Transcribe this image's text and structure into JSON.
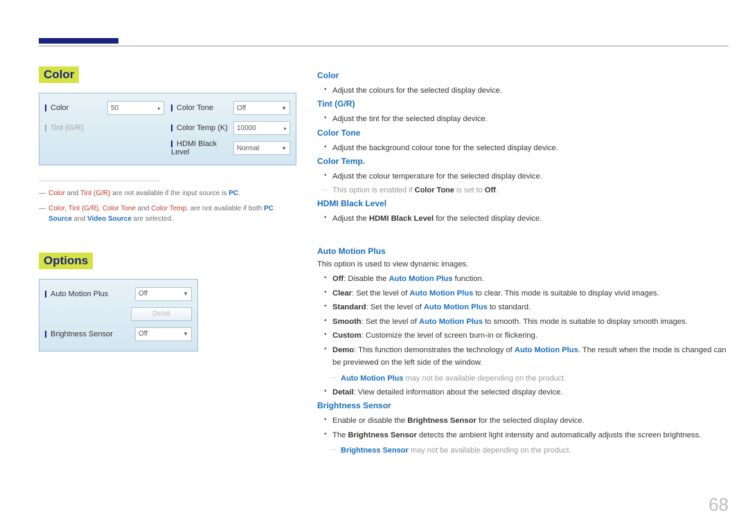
{
  "page_number": "68",
  "left": {
    "section1_heading": "Color",
    "section2_heading": "Options",
    "panel1": {
      "color_label": "Color",
      "color_value": "50",
      "tint_label": "Tint (G/R)",
      "tone_label": "Color Tone",
      "tone_value": "Off",
      "tempk_label": "Color Temp (K)",
      "tempk_value": "10000",
      "hdmi_label": "HDMI Black Level",
      "hdmi_value": "Normal"
    },
    "panel2": {
      "amp_label": "Auto Motion Plus",
      "amp_value": "Off",
      "detail_btn": "Detail",
      "bsense_label": "Brightness Sensor",
      "bsense_value": "Off"
    },
    "note1_a": "Color",
    "note1_b": " and ",
    "note1_c": "Tint (G/R)",
    "note1_d": " are not available if the input source is ",
    "note1_e": "PC",
    "note1_f": ".",
    "note2_a": "Color",
    "note2_b": ", ",
    "note2_c": "Tint (G/R)",
    "note2_d": ", ",
    "note2_e": "Color Tone",
    "note2_f": " and ",
    "note2_g": "Color Temp.",
    "note2_h": " are not available if both ",
    "note2_i": "PC Source",
    "note2_j": " and ",
    "note2_k": "Video Source",
    "note2_l": " are selected."
  },
  "right": {
    "color_h": "Color",
    "color_li": "Adjust the colours for the selected display device.",
    "tint_h": "Tint (G/R)",
    "tint_li": "Adjust the tint for the selected display device.",
    "tone_h": "Color Tone",
    "tone_li": "Adjust the background colour tone for the selected display device.",
    "temp_h": "Color Temp.",
    "temp_li": "Adjust the colour temperature for the selected display device.",
    "temp_note_a": "This option is enabled if ",
    "temp_note_b": "Color Tone",
    "temp_note_c": " is set to ",
    "temp_note_d": "Off",
    "temp_note_e": ".",
    "hdmi_h": "HDMI Black Level",
    "hdmi_li_a": "Adjust the ",
    "hdmi_li_b": "HDMI Black Level",
    "hdmi_li_c": " for the selected display device.",
    "amp_h": "Auto Motion Plus",
    "amp_intro": "This option is used to view dynamic images.",
    "amp_off_a": "Off",
    "amp_off_b": ": Disable the ",
    "amp_off_c": "Auto Motion Plus",
    "amp_off_d": " function.",
    "amp_clear_a": "Clear",
    "amp_clear_b": ": Set the level of ",
    "amp_clear_c": "Auto Motion Plus",
    "amp_clear_d": " to clear. This mode is suitable to display vivid images.",
    "amp_std_a": "Standard",
    "amp_std_b": ": Set the level of ",
    "amp_std_c": "Auto Motion Plus",
    "amp_std_d": " to standard.",
    "amp_smooth_a": "Smooth",
    "amp_smooth_b": ": Set the level of ",
    "amp_smooth_c": "Auto Motion Plus",
    "amp_smooth_d": " to smooth. This mode is suitable to display smooth images.",
    "amp_custom_a": "Custom",
    "amp_custom_b": ": Customize the level of screen burn-in or flickering.",
    "amp_demo_a": "Demo",
    "amp_demo_b": ": This function demonstrates the technology of ",
    "amp_demo_c": "Auto Motion Plus",
    "amp_demo_d": ". The result when the mode is changed can be previewed on the left side of the window.",
    "amp_note_a": "Auto Motion Plus",
    "amp_note_b": " may not be available depending on the product.",
    "amp_detail_a": "Detail",
    "amp_detail_b": ": View detailed information about the selected display device.",
    "bs_h": "Brightness Sensor",
    "bs_li1_a": "Enable or disable the ",
    "bs_li1_b": "Brightness Sensor",
    "bs_li1_c": " for the selected display device.",
    "bs_li2_a": "The ",
    "bs_li2_b": "Brightness Sensor",
    "bs_li2_c": " detects the ambient light intensity and automatically adjusts the screen brightness.",
    "bs_note_a": "Brightness Sensor",
    "bs_note_b": " may not be available depending on the product."
  }
}
